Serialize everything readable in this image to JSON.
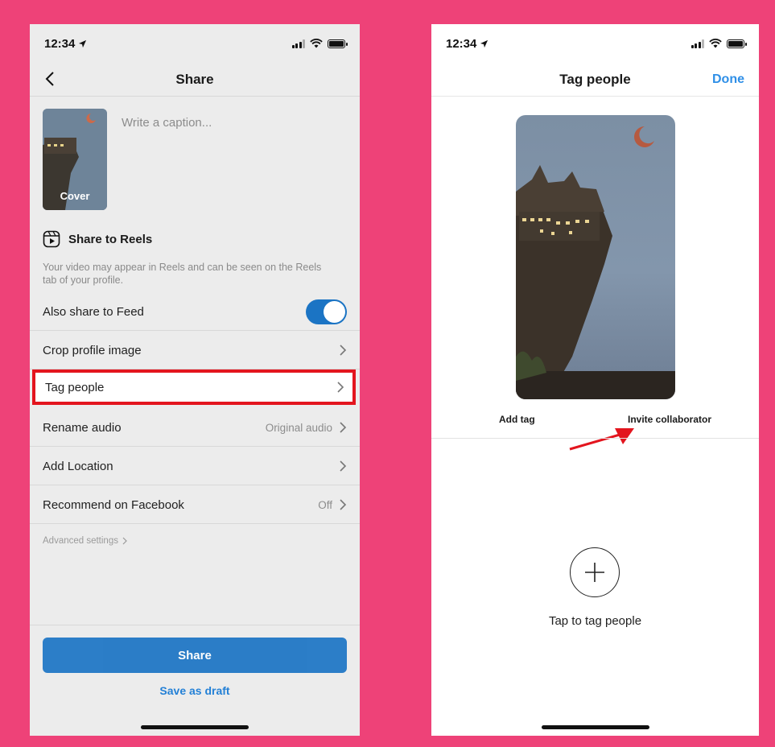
{
  "left_screen": {
    "status": {
      "time": "12:34"
    },
    "nav": {
      "title": "Share"
    },
    "cover": {
      "label": "Cover"
    },
    "caption": {
      "placeholder": "Write a caption..."
    },
    "reels": {
      "title": "Share to Reels",
      "description": "Your video may appear in Reels and can be seen on the Reels tab of your profile."
    },
    "rows": {
      "also_share": "Also share to Feed",
      "crop": "Crop profile image",
      "tag_people": "Tag people",
      "rename_audio": "Rename audio",
      "rename_audio_value": "Original audio",
      "add_location": "Add Location",
      "recommend": "Recommend on Facebook",
      "recommend_value": "Off"
    },
    "advanced": "Advanced settings",
    "buttons": {
      "share": "Share",
      "draft": "Save as draft"
    },
    "toggle_on": true
  },
  "right_screen": {
    "status": {
      "time": "12:34"
    },
    "nav": {
      "title": "Tag people",
      "done": "Done"
    },
    "tags": {
      "add_tag": "Add tag",
      "invite": "Invite collaborator"
    },
    "tap_label": "Tap to tag people"
  },
  "colors": {
    "background": "#ee4278",
    "accent_blue": "#1b74c4",
    "highlight_red": "#e3151e",
    "done_blue": "#2f8fe7"
  },
  "icons": [
    "back-chevron-icon",
    "reels-icon",
    "chevron-right-icon",
    "plus-icon",
    "red-arrow-icon",
    "location-arrow-icon",
    "signal-icon",
    "wifi-icon",
    "battery-icon"
  ]
}
